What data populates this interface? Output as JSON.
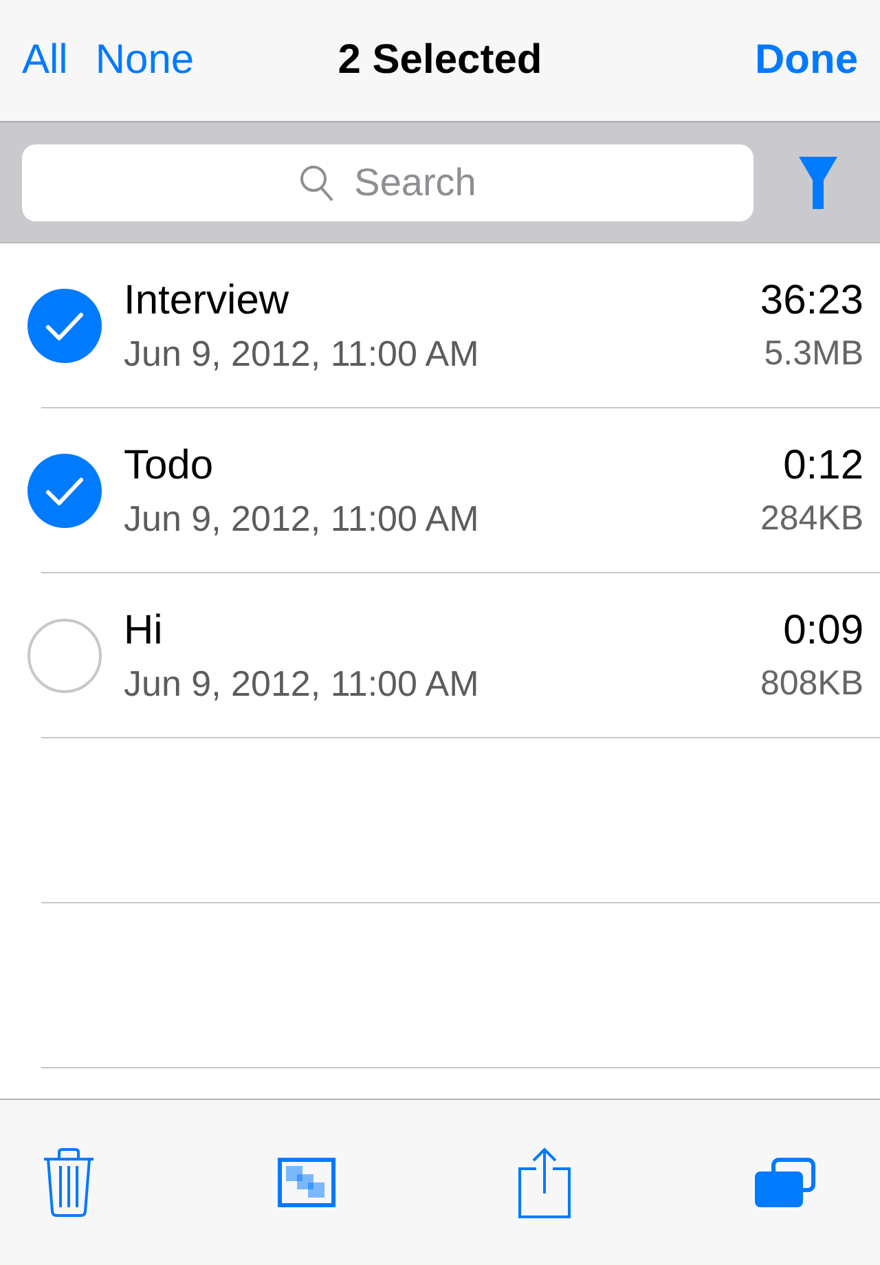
{
  "nav_bar": {
    "left_buttons": [
      {
        "label": "All"
      },
      {
        "label": "None"
      }
    ],
    "title": "2 Selected",
    "done_button": "Done"
  },
  "search": {
    "placeholder": "Search"
  },
  "recordings": [
    {
      "name": "Interview",
      "date": "Jun 9, 2012, 11:00 AM",
      "duration": "36:23",
      "size": "5.3MB",
      "selected": true
    },
    {
      "name": "Todo",
      "date": "Jun 9, 2012, 11:00 AM",
      "duration": "0:12",
      "size": "284KB",
      "selected": true
    },
    {
      "name": "Hi",
      "date": "Jun 9, 2012, 11:00 AM",
      "duration": "0:09",
      "size": "808KB",
      "selected": false
    }
  ]
}
